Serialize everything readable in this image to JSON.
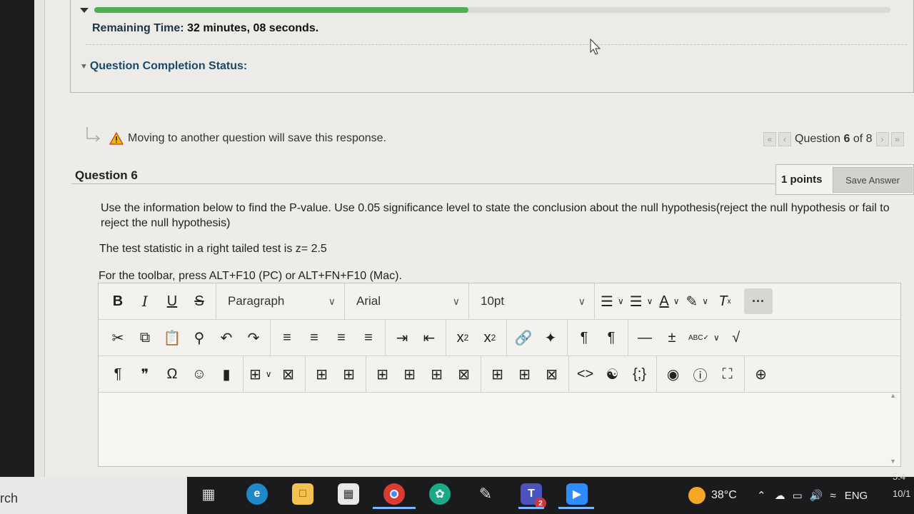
{
  "progress": {
    "fraction": 0.47,
    "color": "#4caf50"
  },
  "status": {
    "remaining_label": "Remaining Time:",
    "remaining_value": "32 minutes, 08 seconds.",
    "completion_label": "Question Completion Status:"
  },
  "nav": {
    "warning": "Moving to another question will save this response.",
    "question_prefix": "Question ",
    "question_number": "6",
    "question_of": " of 8"
  },
  "question": {
    "title": "Question 6",
    "points": "1 points",
    "save_label": "Save Answer",
    "text": "Use the information below to find the P-value. Use 0.05 significance level to state the conclusion about the null hypothesis(reject the null hypothesis or fail to reject the null hypothesis)",
    "statistic": "The test statistic in a right tailed test is z= 2.5",
    "toolbar_hint": "For the toolbar, press ALT+F10 (PC) or ALT+FN+F10 (Mac)."
  },
  "editor": {
    "block_format": "Paragraph",
    "font_family": "Arial",
    "font_size": "10pt"
  },
  "taskbar": {
    "search_text": "rch",
    "weather": "38°C",
    "language": "ENG",
    "time": "5:4",
    "date": "10/1",
    "teams_badge": "2"
  }
}
